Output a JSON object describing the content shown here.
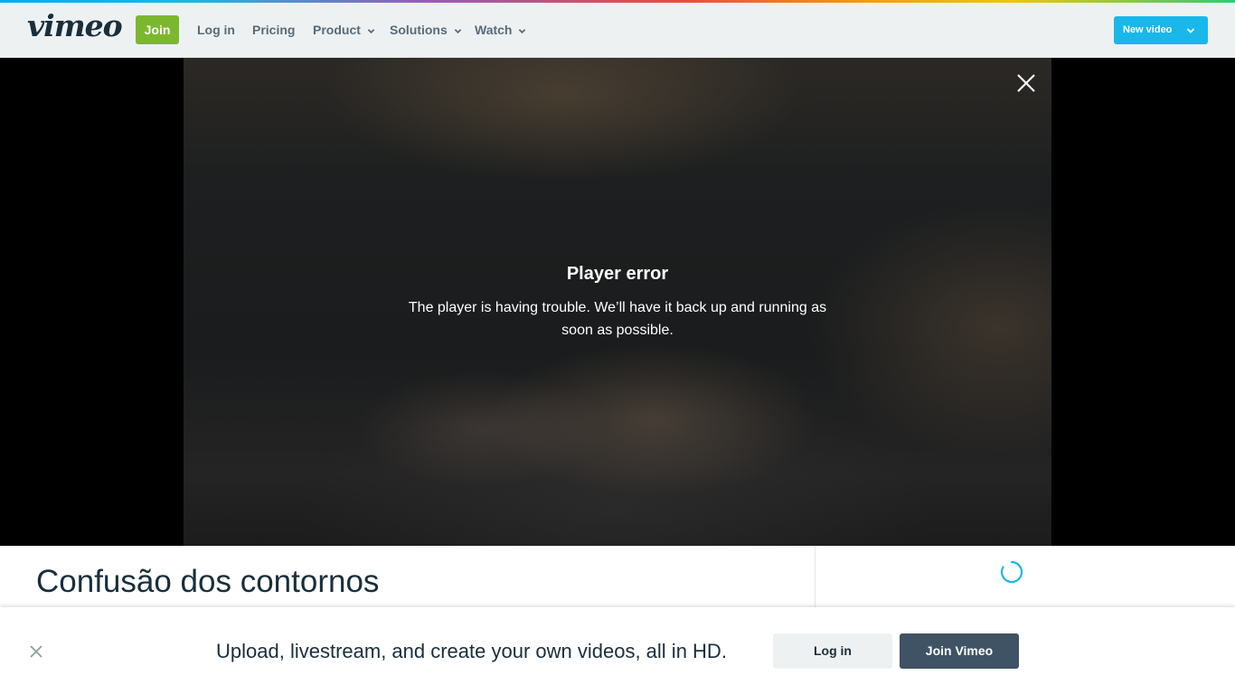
{
  "header": {
    "logo_text": "vimeo",
    "join_label": "Join",
    "nav": [
      {
        "label": "Log in",
        "has_dropdown": false
      },
      {
        "label": "Pricing",
        "has_dropdown": false
      },
      {
        "label": "Product",
        "has_dropdown": true
      },
      {
        "label": "Solutions",
        "has_dropdown": true
      },
      {
        "label": "Watch",
        "has_dropdown": true
      }
    ],
    "new_video_label": "New video"
  },
  "player": {
    "error_title": "Player error",
    "error_message": "The player is having trouble. We’ll have it back up and running as soon as possible.",
    "close_icon": "close-icon"
  },
  "video": {
    "title": "Confusão dos contornos"
  },
  "banner": {
    "text": "Upload, livestream, and create your own videos, all in HD.",
    "login_label": "Log in",
    "join_label": "Join Vimeo"
  },
  "colors": {
    "brand_green": "#7cb82f",
    "accent_blue": "#19b7ea",
    "dark_slate": "#3f5364",
    "text_dark": "#1a2e3b"
  }
}
